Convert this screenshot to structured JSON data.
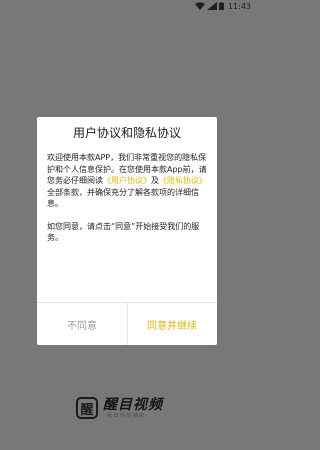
{
  "status_bar": {
    "time": "11:43",
    "icons": [
      "wifi-icon",
      "signal-icon",
      "battery-icon"
    ]
  },
  "dialog": {
    "title": "用户协议和隐私协议",
    "body": {
      "p1_before": "欢迎使用本款APP，我们非常重视您的隐私保护和个人信息保护。在您使用本款App前，请您务必仔细阅读",
      "link_user_agreement": "《用户协议》",
      "and": "及",
      "link_privacy": "《隐私协议》",
      "p1_after": "全部条款，并确保充分了解各款项的详细信息。",
      "p2": "如您同意，请点击“同意”开始接受我们的服务。"
    },
    "buttons": {
      "disagree": "不同意",
      "agree": "同意并继续"
    }
  },
  "brand": {
    "logo_char": "醒",
    "name": "醒目视频",
    "slogan": "看出你的精彩"
  },
  "colors": {
    "overlay": "#787878",
    "accent": "#e6b500",
    "muted": "#9a9a9a"
  }
}
